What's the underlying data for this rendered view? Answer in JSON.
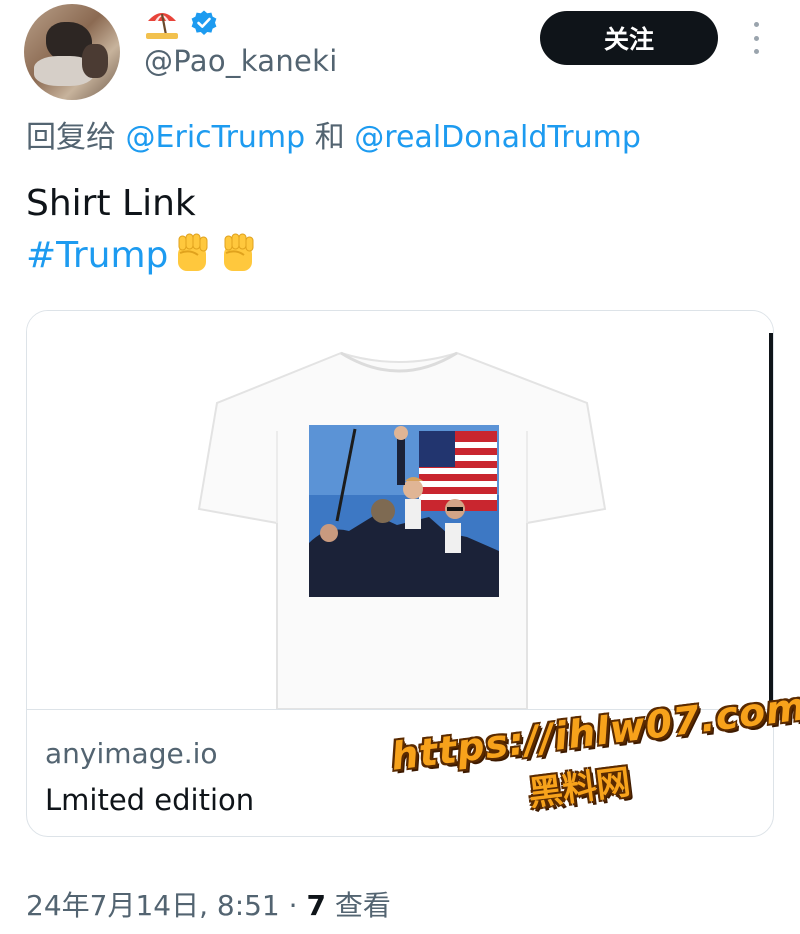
{
  "author": {
    "display_name_icon": "beach-umbrella-emoji",
    "verified_icon": "verified-badge-icon",
    "handle": "@Pao_kaneki",
    "follow_label": "关注"
  },
  "reply": {
    "prefix": "回复给",
    "mention1": "@EricTrump",
    "conjunction": "和",
    "mention2": "@realDonaldTrump"
  },
  "tweet": {
    "line1": "Shirt Link",
    "hashtag": "#Trump",
    "emoji": "raised-fist-emoji"
  },
  "card": {
    "domain": "anyimage.io",
    "title": "Lmited edition"
  },
  "watermark": {
    "url": "https://ihlw07.com",
    "text": "黑料网"
  },
  "meta": {
    "datetime": "24年7月14日, 8:51",
    "separator": "·",
    "views_count": "7",
    "views_label": "查看"
  },
  "colors": {
    "link": "#1d9bf0",
    "secondary_text": "#536471",
    "primary_text": "#0f1419",
    "follow_button_bg": "#0f1419",
    "watermark_fill": "#f7a21b"
  }
}
